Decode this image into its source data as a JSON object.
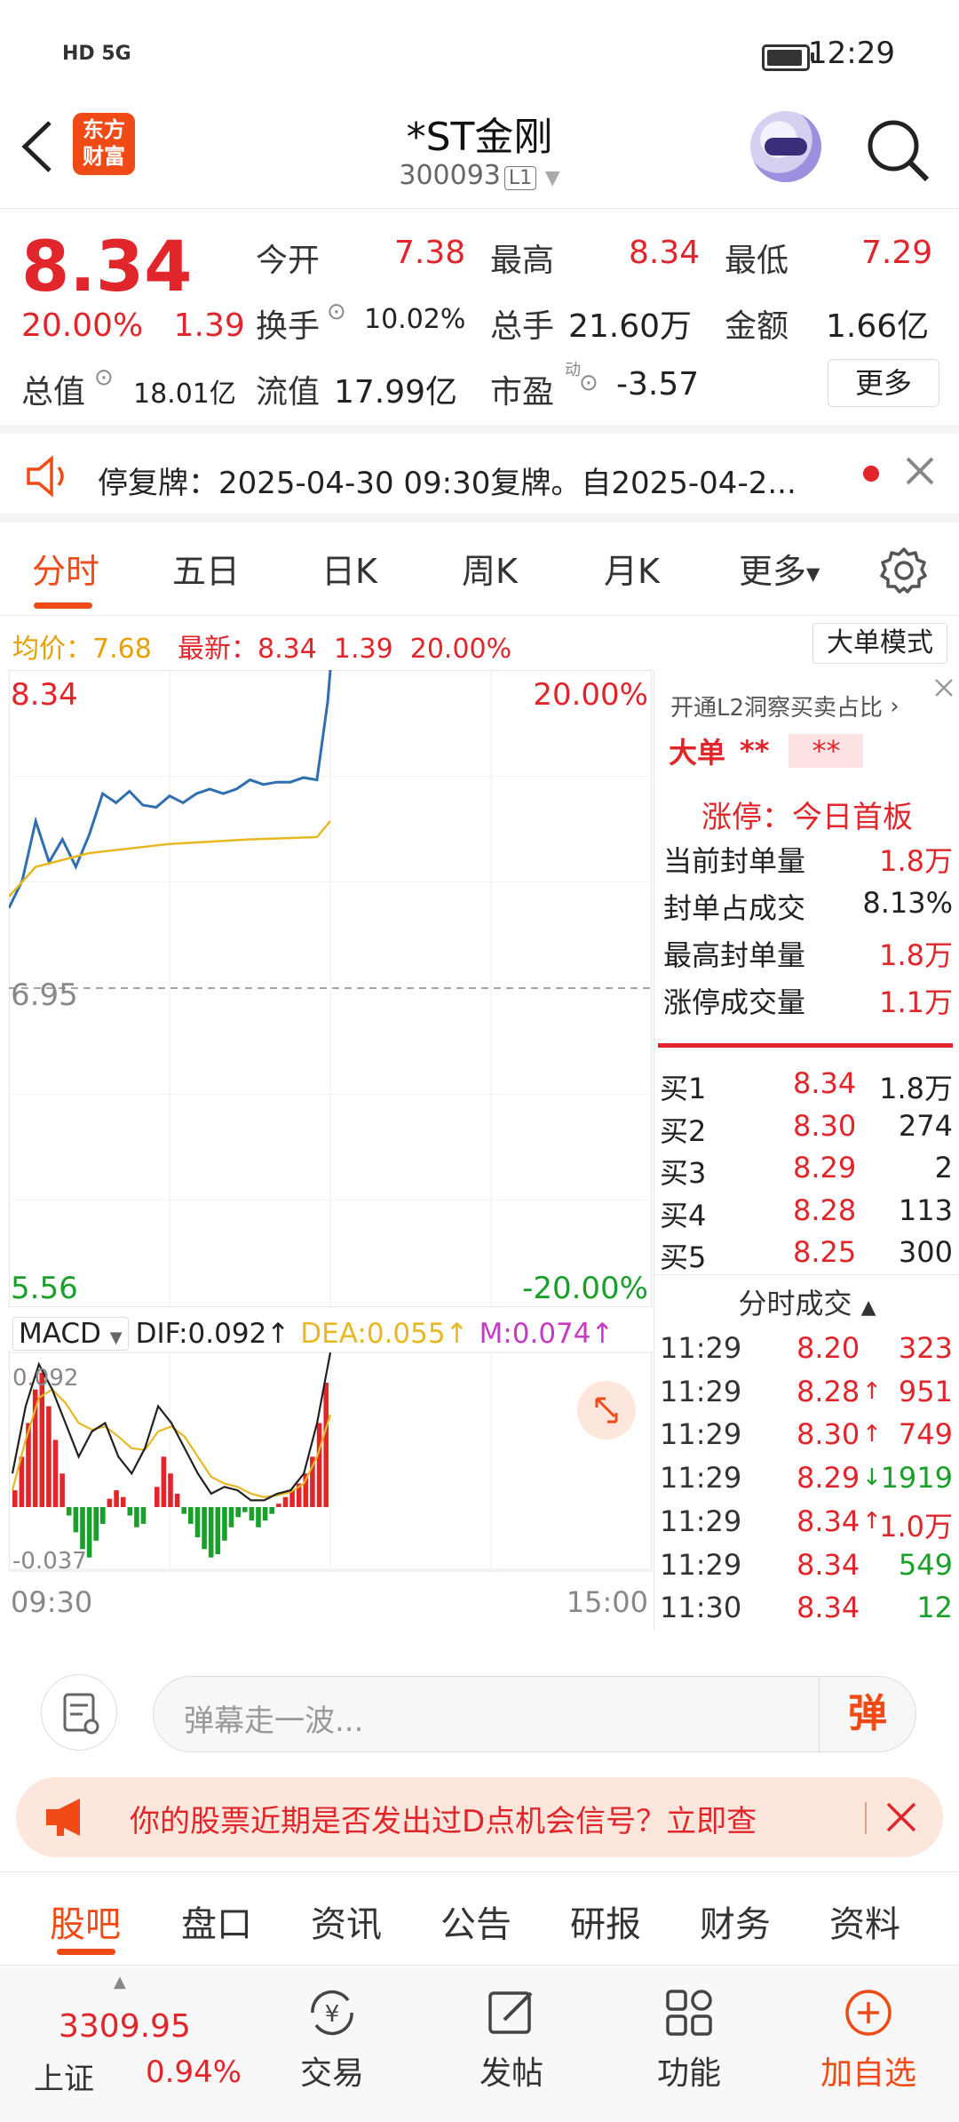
{
  "status_bar": {
    "network": "HD 5G",
    "time": "12:29"
  },
  "header": {
    "logo_text": "东方财富",
    "title": "*ST金刚",
    "code": "300093",
    "level_badge": "L1"
  },
  "quote": {
    "price": "8.34",
    "change_pct": "20.00%",
    "change": "1.39",
    "open_label": "今开",
    "open": "7.38",
    "high_label": "最高",
    "high": "8.34",
    "low_label": "最低",
    "low": "7.29",
    "turnover_label": "换手",
    "turnover": "10.02%",
    "volume_label": "总手",
    "volume": "21.60万",
    "amount_label": "金额",
    "amount": "1.66亿",
    "total_cap_label": "总值",
    "total_cap": "18.01亿",
    "float_cap_label": "流值",
    "float_cap": "17.99亿",
    "pe_label": "市盈",
    "pe_sup": "动",
    "pe": "-3.57",
    "more_label": "更多"
  },
  "notice": {
    "text": "停复牌：2025-04-30 09:30复牌。自2025-04-2..."
  },
  "chart_tabs": [
    {
      "label": "分时"
    },
    {
      "label": "五日"
    },
    {
      "label": "日K"
    },
    {
      "label": "周K"
    },
    {
      "label": "月K"
    },
    {
      "label": "更多"
    }
  ],
  "summary": {
    "avg_label": "均价：",
    "avg": "7.68",
    "latest_label": "最新：",
    "latest": "8.34",
    "chg": "1.39",
    "pct": "20.00%",
    "big_order_mode": "大单模式"
  },
  "chart": {
    "price_top": "8.34",
    "pct_top": "20.00%",
    "mid": "6.95",
    "price_bottom": "5.56",
    "pct_bottom": "-20.00%",
    "macd_label": "MACD",
    "dif": "DIF:0.092",
    "dea": "DEA:0.055",
    "m": "M:0.074",
    "macd_top": "0.092",
    "macd_bottom": "-0.037",
    "time_start": "09:30",
    "time_end": "15:00",
    "colors": {
      "price_line": "#2f6fb0",
      "avg_line": "#e8b822",
      "up": "#e0262b",
      "down": "#1aa02a"
    }
  },
  "chart_data": {
    "type": "line",
    "x_range": [
      "09:30",
      "15:00"
    ],
    "ylim": [
      5.56,
      8.34
    ],
    "reference_price": 6.95,
    "series": [
      {
        "name": "价格",
        "x": [
          "09:30",
          "09:35",
          "09:40",
          "09:45",
          "09:50",
          "09:55",
          "10:00",
          "10:05",
          "10:10",
          "10:15",
          "10:20",
          "10:25",
          "10:30",
          "10:35",
          "10:40",
          "10:45",
          "10:50",
          "10:55",
          "11:00",
          "11:05",
          "11:10",
          "11:15",
          "11:20",
          "11:25",
          "11:29",
          "11:30"
        ],
        "values": [
          7.3,
          7.42,
          7.68,
          7.5,
          7.6,
          7.48,
          7.62,
          7.8,
          7.76,
          7.81,
          7.75,
          7.74,
          7.79,
          7.76,
          7.8,
          7.82,
          7.8,
          7.82,
          7.86,
          7.84,
          7.85,
          7.85,
          7.87,
          7.86,
          8.2,
          8.34
        ]
      },
      {
        "name": "均价",
        "x": [
          "09:30",
          "09:40",
          "10:00",
          "10:30",
          "11:00",
          "11:25",
          "11:30"
        ],
        "values": [
          7.35,
          7.48,
          7.54,
          7.58,
          7.6,
          7.61,
          7.68
        ]
      }
    ],
    "macd": {
      "dif": 0.092,
      "dea": 0.055,
      "m": 0.074,
      "ylim": [
        -0.037,
        0.092
      ]
    }
  },
  "right_panel": {
    "l2_promo": "开通L2洞察买卖占比",
    "big_order_label": "大单",
    "big_order_val1": "**",
    "big_order_val2": "**",
    "limit_title": "涨停：今日首板",
    "stats": [
      {
        "label": "当前封单量",
        "value": "1.8万"
      },
      {
        "label": "封单占成交",
        "value": "8.13%"
      },
      {
        "label": "最高封单量",
        "value": "1.8万"
      },
      {
        "label": "涨停成交量",
        "value": "1.1万"
      }
    ],
    "bids": [
      {
        "label": "买1",
        "price": "8.34",
        "vol": "1.8万"
      },
      {
        "label": "买2",
        "price": "8.30",
        "vol": "274"
      },
      {
        "label": "买3",
        "price": "8.29",
        "vol": "2"
      },
      {
        "label": "买4",
        "price": "8.28",
        "vol": "113"
      },
      {
        "label": "买5",
        "price": "8.25",
        "vol": "300"
      }
    ],
    "trades_title": "分时成交",
    "trades": [
      {
        "time": "11:29",
        "price": "8.20",
        "vol": "323",
        "arrow": ""
      },
      {
        "time": "11:29",
        "price": "8.28",
        "vol": "951",
        "arrow": "↑"
      },
      {
        "time": "11:29",
        "price": "8.30",
        "vol": "749",
        "arrow": "↑"
      },
      {
        "time": "11:29",
        "price": "8.29",
        "vol": "1919",
        "arrow": "↓"
      },
      {
        "time": "11:29",
        "price": "8.34",
        "vol": "1.0万",
        "arrow": "↑"
      },
      {
        "time": "11:29",
        "price": "8.34",
        "vol": "549",
        "arrow": ""
      },
      {
        "time": "11:30",
        "price": "8.34",
        "vol": "12",
        "arrow": ""
      }
    ]
  },
  "comment": {
    "placeholder": "弹幕走一波...",
    "dan": "弹"
  },
  "ad": {
    "text": "你的股票近期是否发出过D点机会信号？立即查"
  },
  "bottom_tabs": [
    {
      "label": "股吧"
    },
    {
      "label": "盘口"
    },
    {
      "label": "资讯"
    },
    {
      "label": "公告"
    },
    {
      "label": "研报"
    },
    {
      "label": "财务"
    },
    {
      "label": "资料"
    }
  ],
  "footer": {
    "index_value": "3309.95",
    "index_name": "上证",
    "index_pct": "0.94%",
    "items": [
      {
        "label": "交易"
      },
      {
        "label": "发帖"
      },
      {
        "label": "功能"
      },
      {
        "label": "加自选"
      }
    ]
  }
}
